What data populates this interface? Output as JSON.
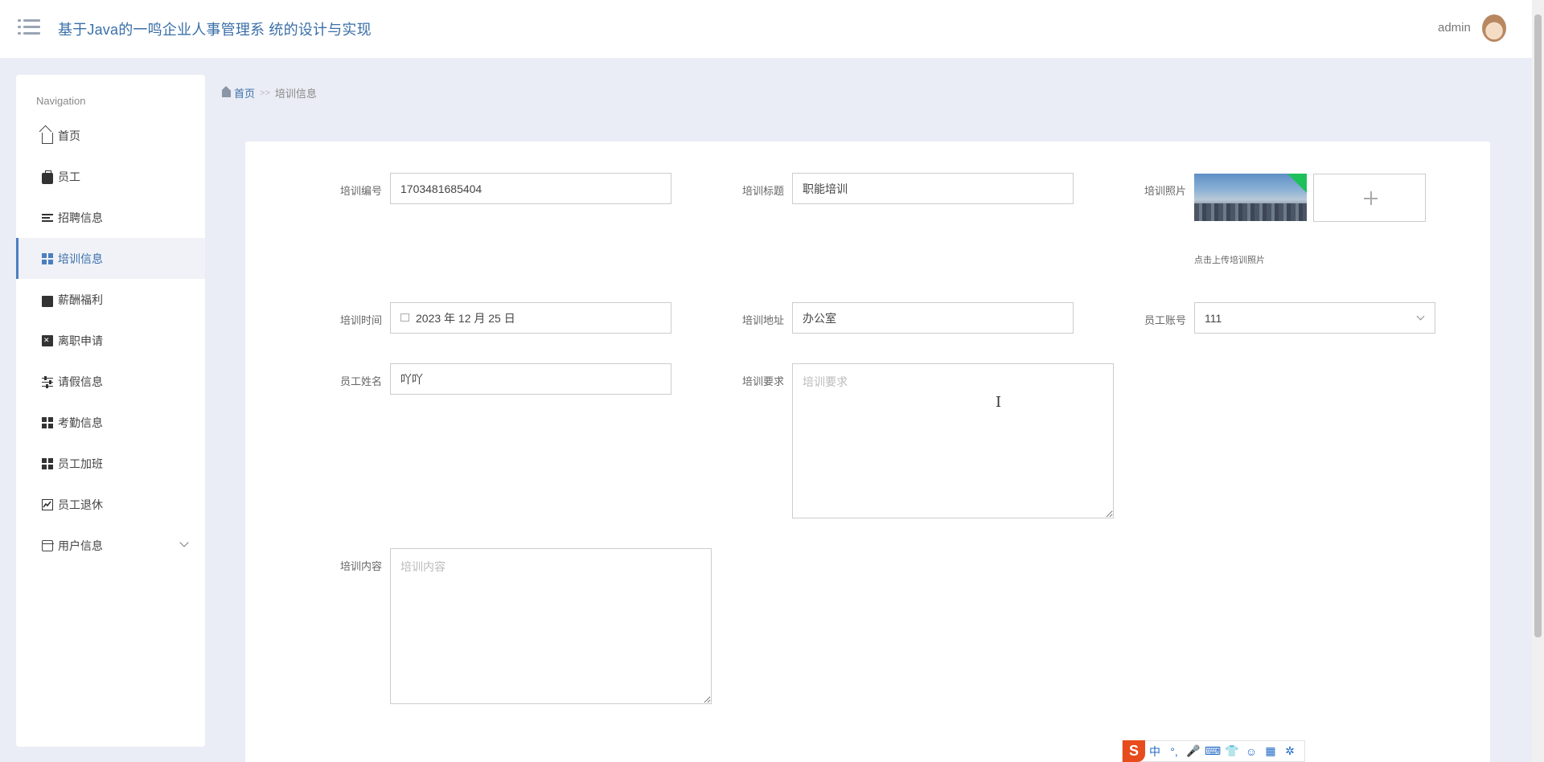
{
  "header": {
    "app_title": "基于Java的一鸣企业人事管理系 统的设计与实现",
    "user_name": "admin"
  },
  "sidebar": {
    "title": "Navigation",
    "items": [
      {
        "label": "首页",
        "icon": "home-icon"
      },
      {
        "label": "员工",
        "icon": "briefcase-icon"
      },
      {
        "label": "招聘信息",
        "icon": "list-icon"
      },
      {
        "label": "培训信息",
        "icon": "grid-icon",
        "active": true
      },
      {
        "label": "薪酬福利",
        "icon": "printer-icon"
      },
      {
        "label": "离职申请",
        "icon": "clipboard-x-icon"
      },
      {
        "label": "请假信息",
        "icon": "sliders-icon"
      },
      {
        "label": "考勤信息",
        "icon": "grid-icon"
      },
      {
        "label": "员工加班",
        "icon": "grid-icon"
      },
      {
        "label": "员工退休",
        "icon": "line-chart-icon"
      },
      {
        "label": "用户信息",
        "icon": "wallet-icon",
        "expandable": true
      }
    ]
  },
  "breadcrumb": {
    "home": "首页",
    "separator": ">>",
    "current": "培训信息"
  },
  "form": {
    "training_no": {
      "label": "培训编号",
      "value": "1703481685404"
    },
    "training_title": {
      "label": "培训标题",
      "value": "职能培训"
    },
    "training_photo": {
      "label": "培训照片",
      "hint": "点击上传培训照片"
    },
    "training_time": {
      "label": "培训时间",
      "value": "2023 年 12 月 25 日"
    },
    "training_address": {
      "label": "培训地址",
      "value": "办公室"
    },
    "employee_account": {
      "label": "员工账号",
      "value": "111"
    },
    "employee_name": {
      "label": "员工姓名",
      "value": "吖吖"
    },
    "training_requirements": {
      "label": "培训要求",
      "placeholder": "培训要求",
      "value": ""
    },
    "training_content": {
      "label": "培训内容",
      "placeholder": "培训内容",
      "value": ""
    }
  },
  "ime_toolbar": {
    "logo": "S",
    "items": [
      "中",
      "°,",
      "🎤",
      "⌨",
      "👕",
      "☺",
      "▦",
      "✲"
    ]
  },
  "colors": {
    "accent": "#3a6fa8",
    "page_bg": "#eaedf5",
    "active_border": "#4c7fc0",
    "ime_brand": "#e84b1c"
  }
}
